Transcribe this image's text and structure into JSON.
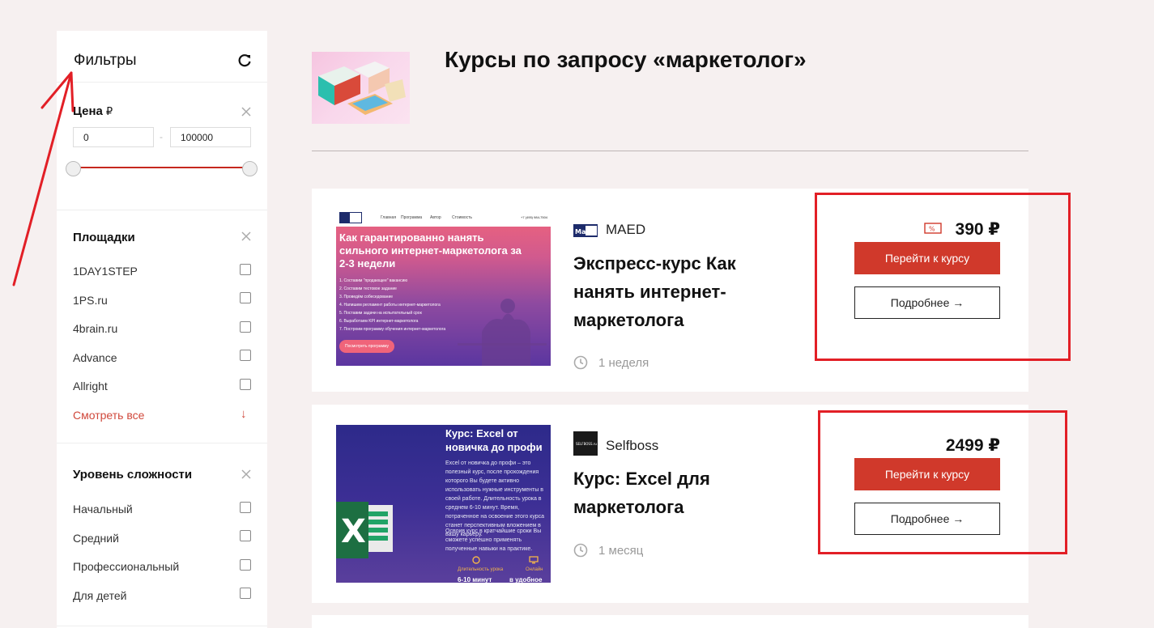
{
  "filters": {
    "title": "Фильтры",
    "price": {
      "title": "Цена",
      "currency": "₽",
      "min": "0",
      "max": "100000"
    },
    "platforms": {
      "title": "Площадки",
      "items": [
        "1DAY1STEP",
        "1PS.ru",
        "4brain.ru",
        "Advance",
        "Allright"
      ],
      "see_all": "Смотреть все"
    },
    "level": {
      "title": "Уровень сложности",
      "items": [
        "Начальный",
        "Средний",
        "Профессиональный",
        "Для детей"
      ]
    }
  },
  "header": {
    "title": "Курсы по запросу «маркетолог»"
  },
  "courses": [
    {
      "provider": "MAED",
      "logo_text": "Ma Ed",
      "title": "Экспресс-курс Как нанять интернет-маркетолога",
      "duration": "1 неделя",
      "price": "390 ₽",
      "cta": "Перейти к курсу",
      "more": "Подробнее →",
      "thumb": {
        "nav": [
          "Главная",
          "Программа",
          "Автор",
          "Стоимость"
        ],
        "phone": "+7 (495) 984-7504",
        "headline": "Как гарантированно нанять сильного интернет-маркетолога за 2-3 недели",
        "steps": [
          "1. Составим \"продающее\" вакансию",
          "2. Составим тестовое задание",
          "3. Проведём собеседование",
          "4. Напишем регламент работы интернет-маркетолога",
          "5. Поставим задачи на испытательный срок",
          "6. Выработаем KPI интернет-маркетолога",
          "7. Построим программу обучения интернет-маркетолога"
        ],
        "button": "Посмотреть программу"
      }
    },
    {
      "provider": "Selfboss",
      "logo_text": "SELFBOSS.ru",
      "title": "Курс: Excel для маркетолога",
      "duration": "1 месяц",
      "price": "2499 ₽",
      "cta": "Перейти к курсу",
      "more": "Подробнее →",
      "thumb": {
        "headline": "Курс: Excel от новичка до профи",
        "body": "Excel от новичка до профи – это полезный курс, после прохождения которого Вы будете активно использовать нужные инструменты в своей работе. Длительность урока в среднем 6-10 минут. Время, потраченное на освоение этого курса станет перспективным вложением в вашу карьеру.",
        "body2": "Освоив курс в кратчайшие сроки Вы сможете успешно применять полученные навыки на практике.",
        "label_left": "Длительность урока",
        "label_right": "Онлайн",
        "bottom_left": "6-10 минут",
        "bottom_right": "в удобное время",
        "logo_letter": "X"
      }
    }
  ],
  "colors": {
    "accent": "#d0392b",
    "highlight": "#e21f26",
    "background": "#f6f0f0"
  }
}
